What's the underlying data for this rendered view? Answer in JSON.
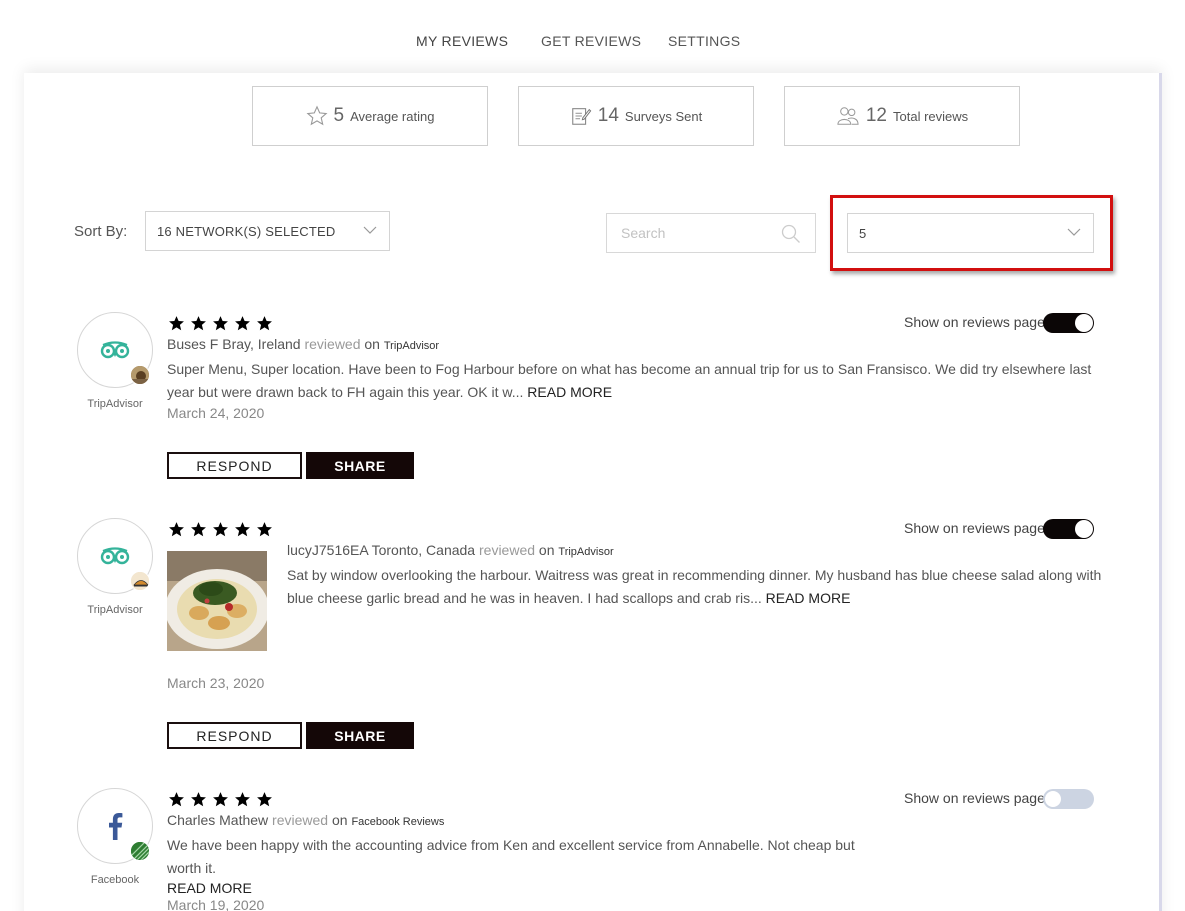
{
  "nav": {
    "tabs": [
      {
        "label": "MY REVIEWS",
        "active": true
      },
      {
        "label": "GET REVIEWS",
        "active": false
      },
      {
        "label": "SETTINGS",
        "active": false
      }
    ]
  },
  "stats": {
    "average_rating": {
      "value": "5",
      "label": "Average rating",
      "icon": "star-outline-icon"
    },
    "surveys_sent": {
      "value": "14",
      "label": "Surveys Sent",
      "icon": "survey-edit-icon"
    },
    "total_reviews": {
      "value": "12",
      "label": "Total reviews",
      "icon": "users-icon"
    }
  },
  "filters": {
    "sort_label": "Sort By:",
    "network_select": "16 NETWORK(S) SELECTED",
    "search_placeholder": "Search",
    "rating_select": "5"
  },
  "toggle_label": "Show on reviews page",
  "actions": {
    "respond": "RESPOND",
    "share": "SHARE",
    "read_more": "READ MORE"
  },
  "reviews": [
    {
      "network": "TripAdvisor",
      "rating": 5,
      "reviewer": "Buses F Bray, Ireland",
      "reviewed_on": "reviewed",
      "on": "on",
      "text": "Super Menu, Super location. Have been to Fog Harbour before on what has become an annual trip for us to San Fransisco. We did try elsewhere last year but were drawn back to FH again this year. OK it w...",
      "date": "March 24, 2020",
      "show_on_page": true
    },
    {
      "network": "TripAdvisor",
      "rating": 5,
      "reviewer": "lucyJ7516EA Toronto, Canada",
      "reviewed_on": "reviewed",
      "on": "on",
      "text": "Sat by window overlooking the harbour. Waitress was great in recommending dinner. My husband has blue cheese salad along with blue cheese garlic bread and he was in heaven. I had scallops and crab ris...",
      "date": "March 23, 2020",
      "show_on_page": true
    },
    {
      "network": "Facebook",
      "network_full": "Facebook Reviews",
      "rating": 5,
      "reviewer": "Charles Mathew",
      "reviewed_on": "reviewed",
      "on": "on",
      "text": "We have been happy with the accounting advice from Ken and excellent service from Annabelle. Not cheap but worth it.",
      "date": "March 19, 2020",
      "show_on_page": false
    }
  ],
  "colors": {
    "tripadvisor_green": "#34b39a",
    "facebook_blue": "#3b5998",
    "highlight_red": "#d20f0f",
    "toggle_on": "#0b0606",
    "toggle_off": "#ccd4e2"
  }
}
